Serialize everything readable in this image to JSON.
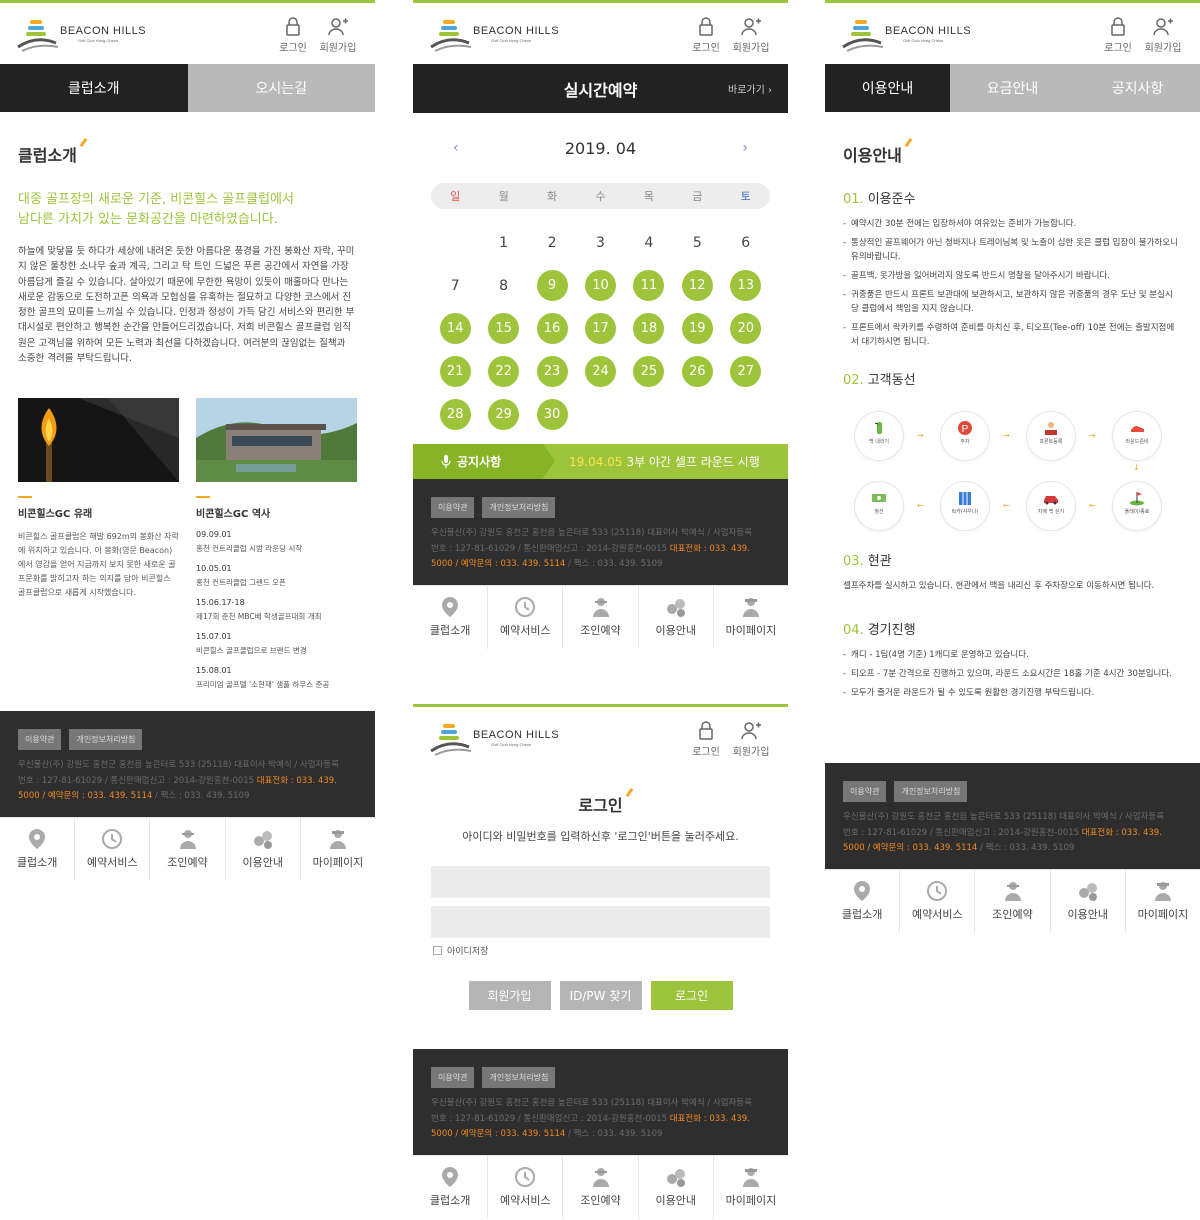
{
  "brand": {
    "name": "BEACON HILLS",
    "sub": "Golf Club Hong Cheon"
  },
  "header": {
    "login": "로그인",
    "join": "회원가입"
  },
  "footer": {
    "terms": "이용약관",
    "privacy": "개인정보처리방침",
    "line1": "우신물산(주) 강원도 홍천군 홍천읍 높은터로 533 (25118) 대표이사 박예식 / 사업자등록",
    "line2a": "번호 : 127-81-61029 / 통신판매업신고 : 2014-강원홍천-0015 ",
    "line2b": "대표전화 : 033. 439.",
    "line3a": "5000 / 예약문의 : 033. 439. 5114",
    "line3b": " / 팩스 : 033. 439. 5109"
  },
  "bottom_nav": [
    "클럽소개",
    "예약서비스",
    "조인예약",
    "이용안내",
    "마이페이지"
  ],
  "club": {
    "tabs": [
      "클럽소개",
      "오시는길"
    ],
    "title": "클럽소개",
    "lead1": "대중 골프장의 새로운 기준, 비콘힐스 골프클럽에서",
    "lead2": "남다른 가치가 있는 문화공간을 마련하였습니다.",
    "para": "하늘에 맞닿을 듯 하다가 세상에 내려온 듯한 아름다운 풍경을 가진 봉화산 자락, 꾸미지 않은 울창한 소나무 숲과 계곡, 그리고 탁 트인 드넓은 푸른 공간에서 자연을 가장 아름답게 즐길 수 있습니다. 살아있기 때문에 무한한 욕망이 있듯이 매홀마다 만나는 새로운 감동으로 도전하고픈 의욕과 모험심을 유혹하는 절묘하고 다양한 코스에서 진정한 골프의 묘미를 느끼실 수 있습니다. 인정과 정성이 가득 담긴 서비스와 편리한 부대시설로 편안하고 행복한 순간을 만들어드리겠습니다. 저희 비콘힐스 골프클럽 임직원은 고객님을 위하여 모든 노력과 최선을 다하겠습니다. 여러분의 끊임없는 질책과 소중한 격려를 부탁드립니다.",
    "card1": {
      "title": "비콘힐스GC 유래",
      "desc": "비콘힐스 골프클럽은 해발 692m의 봉화산 자락에 위치하고 있습니다. 이 봉화(영문 Beacon)에서 영감을 얻어 지금까지 보지 못한 새로운 골프문화를 밝히고자 하는 의지를 담아 비콘힐스 골프클럽으로 새롭게 시작했습니다."
    },
    "card2": {
      "title": "비콘힐스GC 역사",
      "history": [
        {
          "year": "09.09.01",
          "desc": "홍천 컨트리클럽 시범 라운딩 시작"
        },
        {
          "year": "10.05.01",
          "desc": "홍천 컨트리클럽 그랜드 오픈"
        },
        {
          "year": "15.06.17-18",
          "desc": "제17회 춘천 MBC배 학생골프대회 개최"
        },
        {
          "year": "15.07.01",
          "desc": "비콘힐스 골프클럽으로 브랜드 변경"
        },
        {
          "year": "15.08.01",
          "desc": "프리미엄 골프텔 '소현재' 샘플 하우스 준공"
        }
      ]
    }
  },
  "reserve": {
    "title": "실시간예약",
    "go": "바로가기  ›",
    "month": "2019. 04",
    "prev": "‹",
    "next": "›",
    "weekdays": [
      "일",
      "월",
      "화",
      "수",
      "목",
      "금",
      "토"
    ],
    "weeks": [
      [
        "",
        "1",
        "2",
        "3",
        "4",
        "5",
        "6"
      ],
      [
        "7",
        "8",
        "9",
        "10",
        "11",
        "12",
        "13"
      ],
      [
        "14",
        "15",
        "16",
        "17",
        "18",
        "19",
        "20"
      ],
      [
        "21",
        "22",
        "23",
        "24",
        "25",
        "26",
        "27"
      ],
      [
        "28",
        "29",
        "30",
        "",
        "",
        "",
        ""
      ]
    ],
    "available_from": 9,
    "available_to": 30,
    "notice_label": "공지사항",
    "notice_date": "19.04.05",
    "notice_text": "3부 야간 셀프 라운드 시행"
  },
  "login": {
    "title": "로그인",
    "desc": "아이디와 비밀번호를 입력하신후 '로그인'버튼을 눌러주세요.",
    "remember": "아이디저장",
    "btn_join": "회원가입",
    "btn_find": "ID/PW 찾기",
    "btn_login": "로그인"
  },
  "guide": {
    "tabs": [
      "이용안내",
      "요금안내",
      "공지사항"
    ],
    "title": "이용안내",
    "s1": {
      "num": "01.",
      "title": "이용준수"
    },
    "rules": [
      "예약시간 30분 전에는 입장하셔야 여유있는 준비가 가능합니다.",
      "통상적인 골프웨어가 아닌 청바지나 트레이닝복 및 노출이 심한 옷은 클럽 입장이 불가하오니 유의바랍니다.",
      "골프백, 옷가방을 잃어버리지 않도록 반드시 명찰을 달아주시기 바랍니다.",
      "귀중품은 반드시 프론트 보관대에 보관하시고, 보관하지 않은 귀중품의 경우 도난 및 분실시 당 클럽에서 책임을 지지 않습니다.",
      "프론트에서 락카키를 수령하여 준비를 마치신 후, 티오프(Tee-off) 10분 전에는 출발지점에서 대기하시면 됩니다."
    ],
    "s2": {
      "num": "02.",
      "title": "고객동선"
    },
    "flow": [
      "백 내리기",
      "주차",
      "프론트등록",
      "라운드준비",
      "정산",
      "락카(샤우나)",
      "차에 백 싣기",
      "플레이/종료"
    ],
    "s3": {
      "num": "03.",
      "title": "현관"
    },
    "s3_text": "셀프주차를 실시하고 있습니다. 현관에서 백을 내리신 후 주차장으로 이동하시면 됩니다.",
    "s4": {
      "num": "04.",
      "title": "경기진행"
    },
    "play": [
      "캐디 - 1팀(4명 기준) 1캐디로 운영하고 있습니다.",
      "티오프 - 7분 간격으로 진행하고 있으며, 라운드 소요시간은 18홀 기준 4시간 30분입니다.",
      "모두가 즐거운 라운드가 될 수 있도록 원활한 경기진행 부탁드립니다."
    ]
  },
  "colors": {
    "accent": "#9dc43b",
    "dark": "#222222",
    "orange": "#f08a24"
  }
}
